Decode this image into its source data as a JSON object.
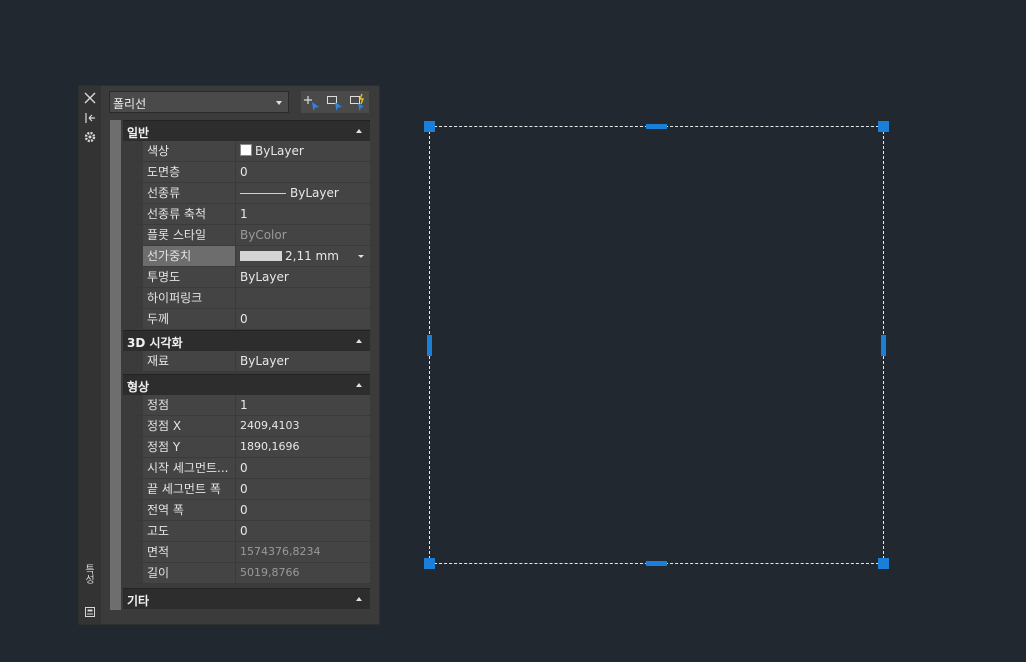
{
  "palette": {
    "strip_label": "특성",
    "object_type": "폴리선",
    "sections": [
      {
        "title": "일반",
        "rows": [
          {
            "name": "색상",
            "value": "ByLayer",
            "kind": "color"
          },
          {
            "name": "도면층",
            "value": "0"
          },
          {
            "name": "선종류",
            "value": "ByLayer",
            "kind": "linetype"
          },
          {
            "name": "선종류 축척",
            "value": "1"
          },
          {
            "name": "플롯 스타일",
            "value": "ByColor",
            "dim": true
          },
          {
            "name": "선가중치",
            "value": "2,11 mm",
            "kind": "weight",
            "selected": true
          },
          {
            "name": "투명도",
            "value": "ByLayer"
          },
          {
            "name": "하이퍼링크",
            "value": ""
          },
          {
            "name": "두께",
            "value": "0"
          }
        ]
      },
      {
        "title": "3D 시각화",
        "rows": [
          {
            "name": "재료",
            "value": "ByLayer"
          }
        ]
      },
      {
        "title": "형상",
        "rows": [
          {
            "name": "정점",
            "value": "1"
          },
          {
            "name": "정점 X",
            "value": "2409,4103",
            "small": true
          },
          {
            "name": "정점 Y",
            "value": "1890,1696",
            "small": true
          },
          {
            "name": "시작 세그먼트...",
            "value": "0"
          },
          {
            "name": "끝 세그먼트 폭",
            "value": "0"
          },
          {
            "name": "전역 폭",
            "value": "0"
          },
          {
            "name": "고도",
            "value": "0"
          },
          {
            "name": "면적",
            "value": "1574376,8234",
            "dim": true,
            "small": true
          },
          {
            "name": "길이",
            "value": "5019,8766",
            "dim": true,
            "small": true
          }
        ]
      },
      {
        "title": "기타",
        "rows": []
      }
    ]
  },
  "icons": {
    "close": "close-icon",
    "autohide": "autohide-icon",
    "settings": "gear-icon",
    "props": "properties-icon",
    "quick_select": "quick-select-icon",
    "select_objects": "select-objects-icon",
    "pickadd": "pickadd-toggle-icon"
  },
  "colors": {
    "grip": "#1a7fd6",
    "canvas": "#212830",
    "palette": "#3b3b3b"
  }
}
